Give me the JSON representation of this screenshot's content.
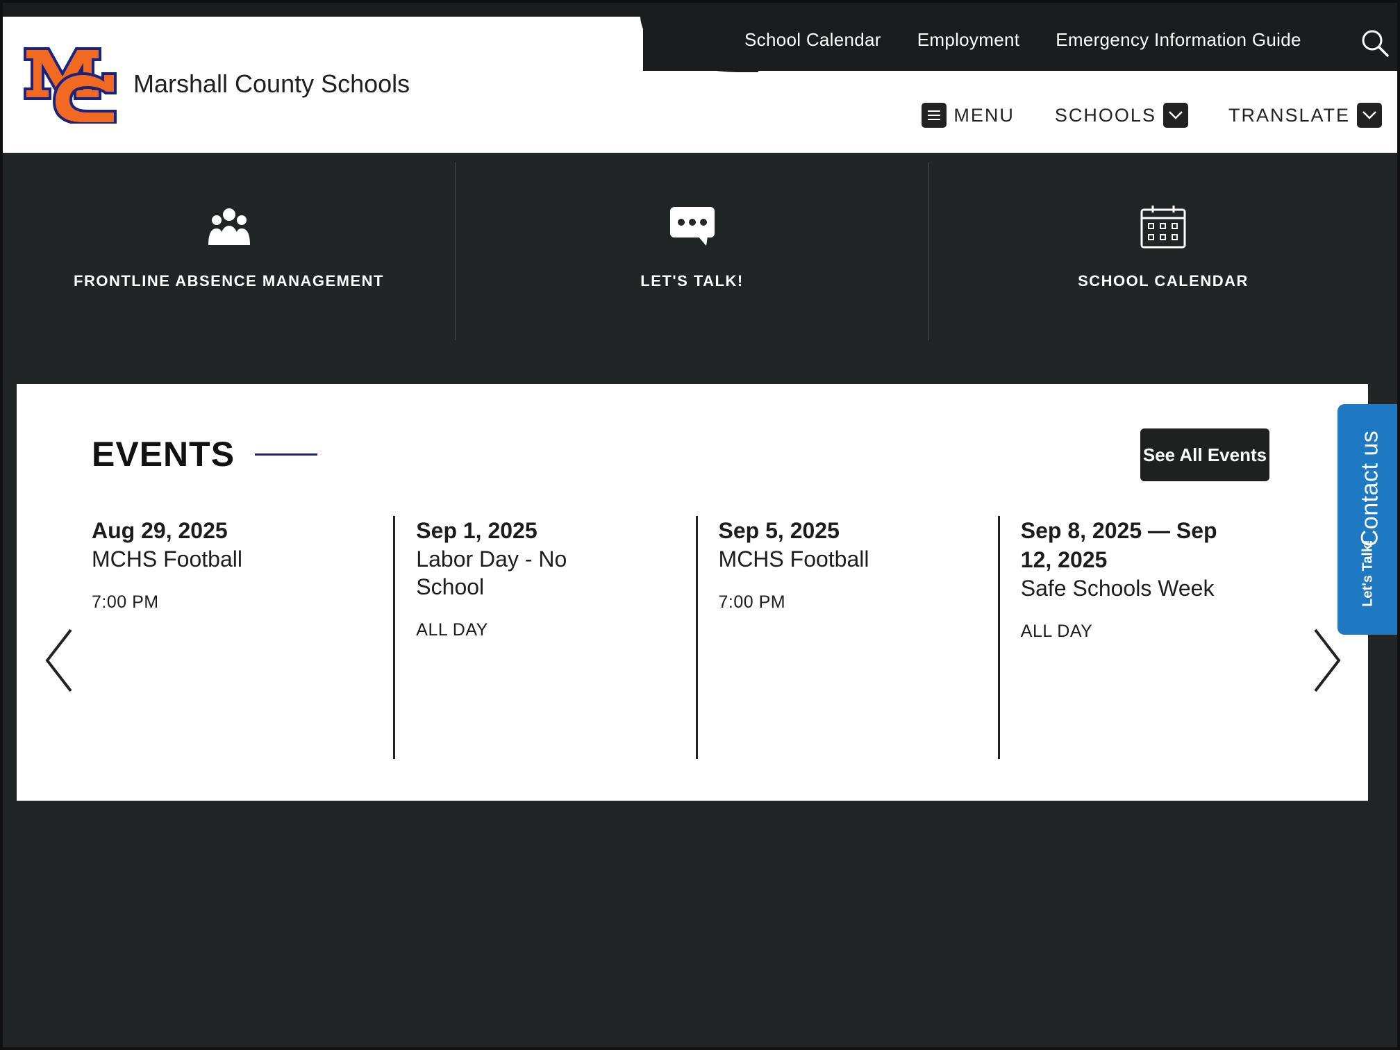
{
  "site": {
    "name": "Marshall County Schools",
    "logo_letters": "MC"
  },
  "utility_nav": [
    "School Calendar",
    "Employment",
    "Emergency Information Guide"
  ],
  "main_nav": {
    "menu": "MENU",
    "schools": "SCHOOLS",
    "translate": "TRANSLATE"
  },
  "quick_links": [
    {
      "label": "FRONTLINE ABSENCE MANAGEMENT",
      "icon": "people-group-icon"
    },
    {
      "label": "LET'S TALK!",
      "icon": "chat-bubble-icon"
    },
    {
      "label": "SCHOOL CALENDAR",
      "icon": "calendar-icon"
    }
  ],
  "events": {
    "title": "EVENTS",
    "see_all": "See All Events",
    "items": [
      {
        "date": "Aug 29, 2025",
        "title": "MCHS Football",
        "time": "7:00 PM"
      },
      {
        "date": "Sep 1, 2025",
        "title": "Labor Day - No School",
        "time": "ALL DAY"
      },
      {
        "date": "Sep 5, 2025",
        "title": "MCHS Football",
        "time": "7:00 PM"
      },
      {
        "date": "Sep 8, 2025 — Sep 12, 2025",
        "title": "Safe Schools Week",
        "time": "ALL DAY"
      }
    ]
  },
  "contact_tab": {
    "label": "Contact us",
    "sub_label": "Let's Talk!"
  },
  "colors": {
    "background": "#222526",
    "accent_orange": "#f26a21",
    "accent_navy": "#1a237e",
    "contact_blue": "#1e78c2"
  }
}
